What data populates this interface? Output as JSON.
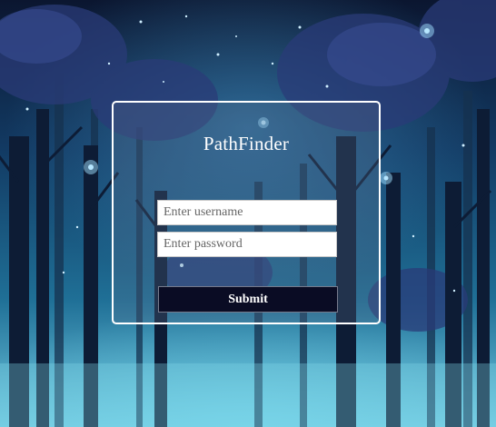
{
  "app": {
    "title": "PathFinder"
  },
  "form": {
    "username_placeholder": "Enter username",
    "password_placeholder": "Enter password",
    "username_value": "",
    "password_value": "",
    "submit_label": "Submit"
  },
  "colors": {
    "card_border": "#ffffff",
    "button_bg": "#0a0c24",
    "title_text": "#ffffff"
  }
}
